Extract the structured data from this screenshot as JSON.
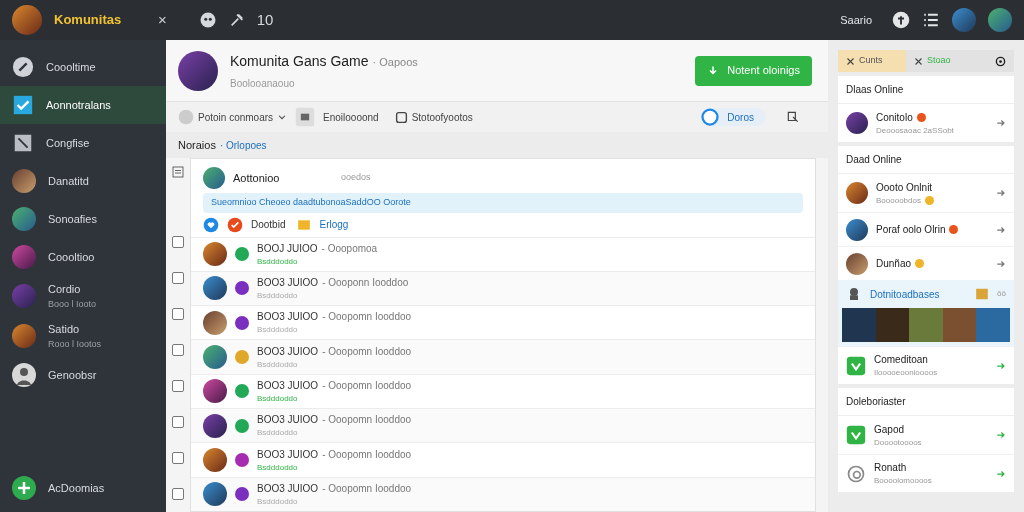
{
  "top_bar": {
    "app_name": "Komunitas",
    "close": "×",
    "count": "10",
    "user_label": "Saario"
  },
  "sidebar": {
    "items": [
      {
        "label": "Coooltime",
        "kind": "pen",
        "selected": false
      },
      {
        "label": "Aonnotralans",
        "kind": "check",
        "selected": true
      },
      {
        "label": "Congfise",
        "kind": "slash",
        "selected": false
      },
      {
        "label": "Danatitd",
        "kind": "avatar",
        "selected": false
      },
      {
        "label": "Sonoafies",
        "kind": "avatar",
        "selected": false
      },
      {
        "label": "Coooltioo",
        "kind": "avatar",
        "selected": false
      },
      {
        "label": "Cordio",
        "sublabel": "Booo l Iooto",
        "kind": "avatar",
        "selected": false
      },
      {
        "label": "Satido",
        "sublabel": "Rooo l Iootos",
        "kind": "avatar",
        "selected": false
      },
      {
        "label": "Genoobsr",
        "kind": "person",
        "selected": false
      }
    ],
    "add_button": "AcDoomias"
  },
  "header": {
    "title": "Komunita Gans Game",
    "tag": "· Oapoos",
    "subtitle": "Boolooanaouo",
    "action_button": "Notent oloinigs"
  },
  "toolbar": {
    "filter": "Potoin conmoars",
    "option_1": "Enoiloooond",
    "option_2": "Stotoofyootos",
    "pill": "Doros"
  },
  "section": {
    "title": "Noraios",
    "link": "· Orlopoes"
  },
  "feed": {
    "featured": {
      "name": "Aottonioo",
      "meta": "ooedos",
      "message": "Sueomnioo Cheoeo daadtubonoaSaddOO Oorote",
      "action_1": "Dootbid",
      "action_2": "Erlogg"
    },
    "rows": [
      {
        "title": "BOOJ JUIOO",
        "detail": "- Ooopomoa",
        "status": "Bsdddoddo",
        "active": true,
        "color": "#22a957",
        "checked": false
      },
      {
        "title": "BOO3 JUIOO",
        "detail": "- Oooponn Iooddoo",
        "status": "Bsdddoddo",
        "active": false,
        "color": "#7b2fbf",
        "checked": false
      },
      {
        "title": "BOO3 JUIOO",
        "detail": "- Ooopomn Iooddoo",
        "status": "Bsdddoddo",
        "active": false,
        "color": "#7b2fbf",
        "checked": false
      },
      {
        "title": "BOO3 JUIOO",
        "detail": "- Ooopomn Iooddoo",
        "status": "Bsdddoddo",
        "active": false,
        "color": "#e0a82a",
        "checked": false
      },
      {
        "title": "BOO3 JUIOO",
        "detail": "- Ooopomn Iooddoo",
        "status": "Bsdddoddo",
        "active": true,
        "color": "#22a957",
        "checked": false
      },
      {
        "title": "BOO3 JUIOO",
        "detail": "- Ooopomn Iooddoo",
        "status": "Bsdddoddo",
        "active": false,
        "color": "#22a957",
        "checked": false
      },
      {
        "title": "BOO3 JUIOO",
        "detail": "- Ooopomn Iooddoo",
        "status": "Bsdddoddo",
        "active": true,
        "color": "#a52bb0",
        "checked": false
      },
      {
        "title": "BOO3 JUIOO",
        "detail": "- Ooopomn Iooddoo",
        "status": "Bsdddoddo",
        "active": false,
        "color": "#7b2fbf",
        "checked": false
      }
    ]
  },
  "right_panel": {
    "tabs": [
      {
        "label": "Cunts",
        "selected": true
      },
      {
        "label": "Stoao",
        "selected": false
      }
    ],
    "cards": [
      {
        "title": "Dlaas Online",
        "items": [
          {
            "kind": "person",
            "name": "Conitolo",
            "sub": "Deooosaoac 2aSSobt",
            "color": "#e8541c"
          }
        ]
      },
      {
        "title": "Daad Online",
        "items": [
          {
            "kind": "person",
            "name": "Oooto Onlnit",
            "sub": "Booooobdos",
            "color": "#f0b429"
          },
          {
            "kind": "person",
            "name": "Poraf oolo Olrin",
            "color": "#e8541c"
          },
          {
            "kind": "person",
            "name": "Dunñao",
            "color": "#f0b429"
          },
          {
            "kind": "gallery",
            "name": "Dotnitoadbases",
            "badge": "ōō"
          },
          {
            "kind": "app",
            "name": "Comeditoan",
            "sub": "Ilooooeoonioooos"
          }
        ]
      },
      {
        "title": "Doleboriaster",
        "items": [
          {
            "kind": "app",
            "name": "Gapod",
            "sub": "Dooootoooos"
          },
          {
            "kind": "ring",
            "name": "Ronath",
            "sub": "Boooolomoooos"
          }
        ]
      }
    ]
  }
}
